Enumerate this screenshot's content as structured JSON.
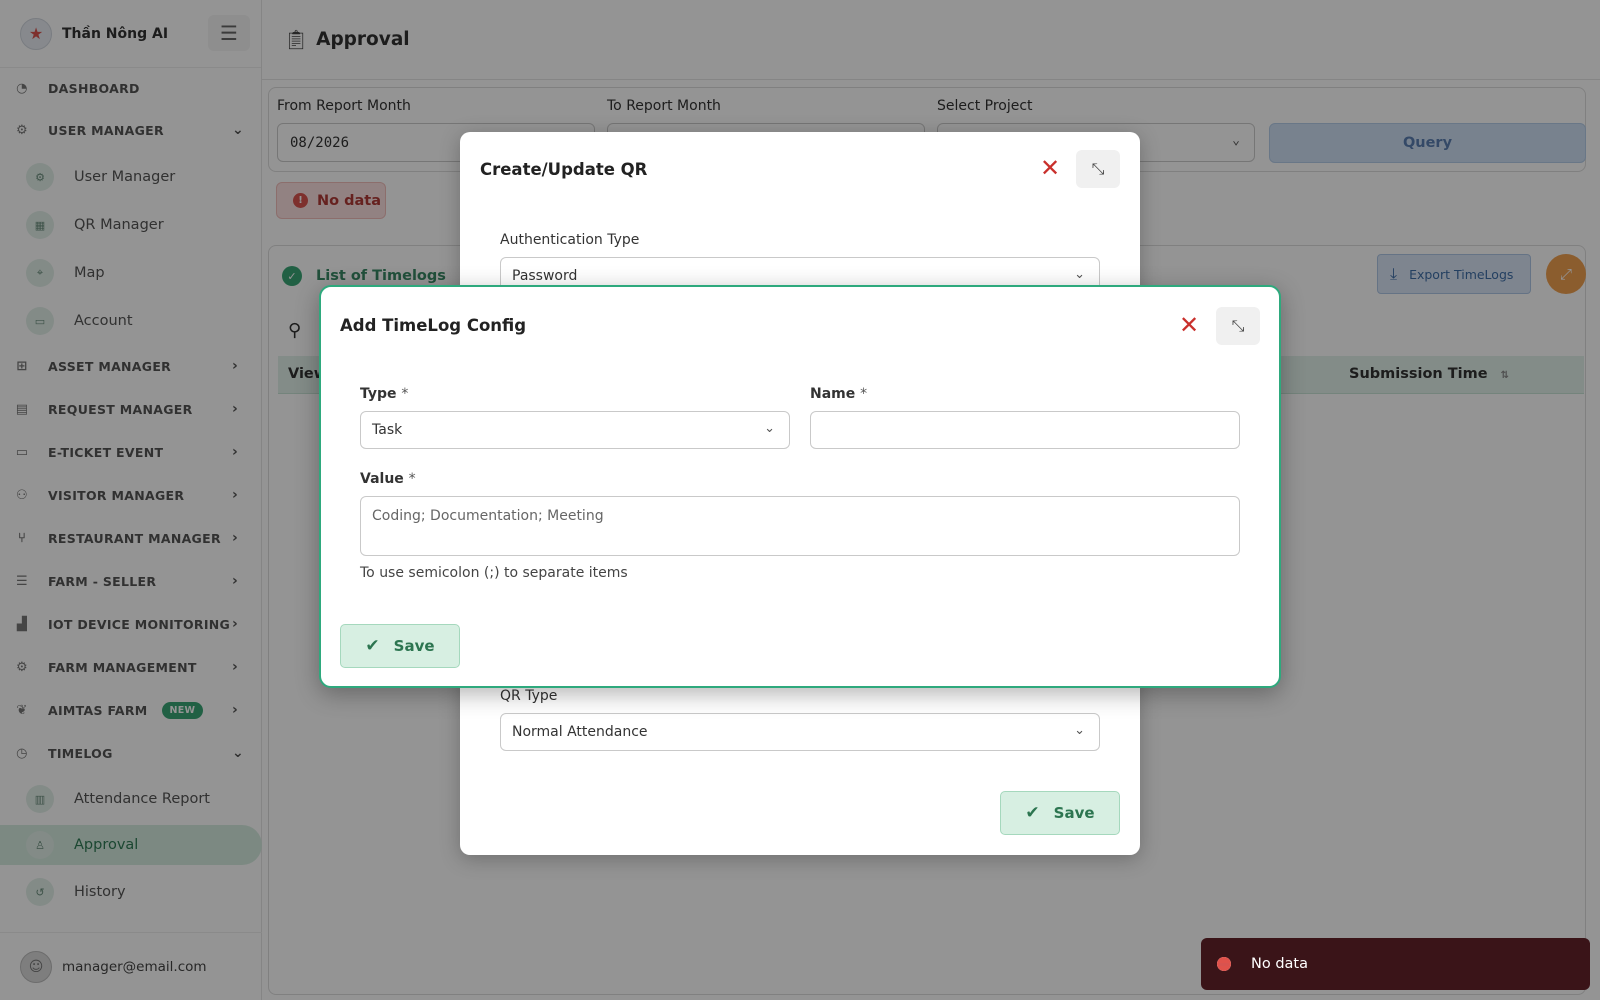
{
  "sidebar": {
    "brand": "Thần Nông AI",
    "nav": [
      {
        "label": "DASHBOARD",
        "icon": "dashboard-icon"
      },
      {
        "label": "USER MANAGER",
        "icon": "users-gear-icon",
        "expanded": true
      },
      {
        "label": "ASSET MANAGER",
        "icon": "sitemap-icon"
      },
      {
        "label": "REQUEST MANAGER",
        "icon": "clipboard-icon"
      },
      {
        "label": "E-TICKET EVENT",
        "icon": "ticket-icon"
      },
      {
        "label": "VISITOR MANAGER",
        "icon": "visitors-icon"
      },
      {
        "label": "RESTAURANT MANAGER",
        "icon": "utensils-icon"
      },
      {
        "label": "FARM - SELLER",
        "icon": "store-icon"
      },
      {
        "label": "IOT DEVICE MONITORING",
        "icon": "chart-icon"
      },
      {
        "label": "FARM MANAGEMENT",
        "icon": "tractor-icon"
      },
      {
        "label": "AIMTAS FARM",
        "icon": "seedling-icon",
        "badge": "NEW"
      },
      {
        "label": "TIMELOG",
        "icon": "clock-icon",
        "expanded": true
      }
    ],
    "user_manager_items": [
      "User Manager",
      "QR Manager",
      "Map",
      "Account"
    ],
    "timelog_items": [
      "Attendance Report",
      "Approval",
      "History"
    ],
    "active_item": "Approval",
    "user_email": "manager@email.com"
  },
  "page": {
    "title": "Approval"
  },
  "filters": {
    "from_label": "From Report Month",
    "from_value": "08/2026",
    "to_label": "To Report Month",
    "project_label": "Select Project",
    "query_label": "Query"
  },
  "status": {
    "no_data": "No data"
  },
  "list": {
    "title": "List of Timelogs",
    "export_label": "Export TimeLogs",
    "columns": [
      "View",
      "Submission Time"
    ]
  },
  "qr_modal": {
    "title": "Create/Update QR",
    "auth_label": "Authentication Type",
    "auth_value": "Password",
    "qr_type_label": "QR Type",
    "qr_type_value": "Normal Attendance",
    "save_label": "Save"
  },
  "timelog_modal": {
    "title": "Add TimeLog Config",
    "type_label": "Type",
    "type_value": "Task",
    "name_label": "Name",
    "name_value": "",
    "value_label": "Value",
    "value_value": "Coding; Documentation; Meeting",
    "required_mark": "*",
    "hint": "To use semicolon (;) to separate items",
    "save_label": "Save"
  },
  "toast": {
    "message": "No data"
  },
  "colors": {
    "primary_green": "#2ea97d",
    "danger_red": "#c9302c",
    "query_blue": "#cfe0f5",
    "toast_bg": "#3a1418"
  }
}
